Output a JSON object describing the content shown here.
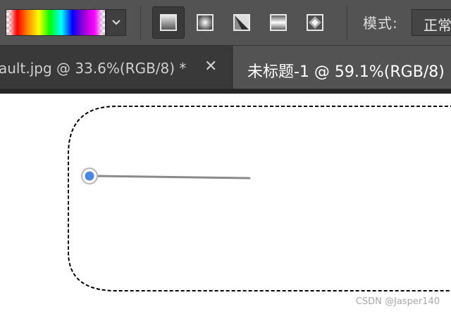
{
  "options_bar": {
    "gradient_picker": {
      "stops": [
        "#e8e8e8",
        "#ff0000",
        "#ff8c00",
        "#ffff00",
        "#00ff00",
        "#00ffff",
        "#0000ff",
        "#9400d3",
        "#ff00ff",
        "#e8e8e8"
      ]
    },
    "gradient_types": [
      {
        "name": "linear-gradient",
        "active": true
      },
      {
        "name": "radial-gradient",
        "active": false
      },
      {
        "name": "angle-gradient",
        "active": false
      },
      {
        "name": "reflected-gradient",
        "active": false
      },
      {
        "name": "diamond-gradient",
        "active": false
      }
    ],
    "mode_label": "模式:",
    "mode_value": "正常"
  },
  "tabs": [
    {
      "title": "ault.jpg @ 33.6%(RGB/8) *",
      "close": "✕",
      "active": false
    },
    {
      "title": "未标题-1 @ 59.1%(RGB/8)",
      "active": true
    }
  ],
  "canvas": {
    "selection": "rounded-rect-marquee",
    "gradient_line": {
      "start_handle": "blue-dot"
    }
  },
  "watermark": "CSDN @Jasper140",
  "colors": {
    "panel": "#535353",
    "tabbar": "#424242",
    "handle": "#4a86e8"
  }
}
